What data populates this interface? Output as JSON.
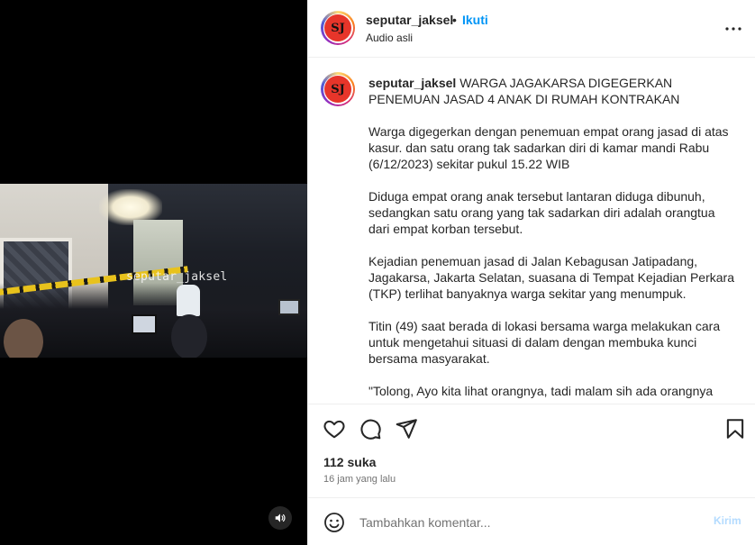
{
  "media": {
    "watermark": "seputar_jaksel",
    "audio_icon": "speaker-icon"
  },
  "header": {
    "username": "seputar_jaksel",
    "separator": "•",
    "follow_label": "Ikuti",
    "audio_label": "Audio asli",
    "avatar_text": "SJ",
    "more_icon": "more-horizontal-icon"
  },
  "caption": {
    "username": "seputar_jaksel",
    "avatar_text": "SJ",
    "headline": "WARGA JAGAKARSA DIGEGERKAN PENEMUAN JASAD 4 ANAK DI RUMAH KONTRAKAN",
    "paragraphs": [
      "Warga digegerkan dengan penemuan empat orang jasad di atas kasur. dan satu orang tak sadarkan diri di kamar mandi Rabu (6/12/2023) sekitar pukul 15.22 WIB",
      "Diduga empat orang anak tersebut lantaran diduga dibunuh, sedangkan satu orang yang tak sadarkan diri adalah orangtua dari empat korban tersebut.",
      "Kejadian penemuan jasad di Jalan Kebagusan Jatipadang, Jagakarsa, Jakarta Selatan, suasana di Tempat Kejadian Perkara (TKP) terlihat banyaknya warga sekitar yang menumpuk.",
      "Titin (49) saat berada di lokasi bersama warga melakukan cara untuk mengetahui situasi di dalam dengan membuka kunci bersama masyarakat.",
      "\"Tolong, Ayo kita lihat orangnya, tadi malam sih ada orangnya"
    ]
  },
  "actions": {
    "like_icon": "heart-icon",
    "comment_icon": "comment-icon",
    "share_icon": "send-icon",
    "save_icon": "bookmark-icon"
  },
  "stats": {
    "likes": "112 suka",
    "time": "16 jam yang lalu"
  },
  "comment": {
    "emoji_icon": "smiley-icon",
    "placeholder": "Tambahkan komentar...",
    "send_label": "Kirim"
  },
  "colors": {
    "accent": "#0095f6",
    "send_disabled": "#b3dbff",
    "text": "#262626",
    "muted": "#737373"
  }
}
